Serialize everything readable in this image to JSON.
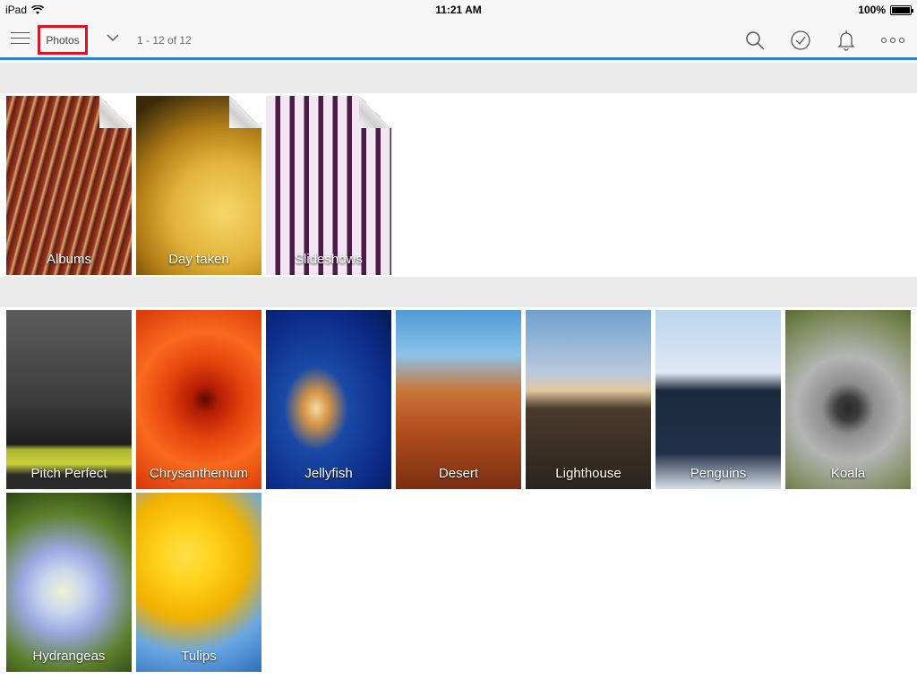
{
  "status_bar": {
    "device": "iPad",
    "time": "11:21 AM",
    "battery": "100%"
  },
  "toolbar": {
    "title": "Photos",
    "count": "1 - 12 of 12"
  },
  "views": [
    {
      "label": "Albums"
    },
    {
      "label": "Day taken"
    },
    {
      "label": "Slideshows"
    }
  ],
  "photos": [
    {
      "label": "Pitch Perfect"
    },
    {
      "label": "Chrysanthemum"
    },
    {
      "label": "Jellyfish"
    },
    {
      "label": "Desert"
    },
    {
      "label": "Lighthouse"
    },
    {
      "label": "Penguins"
    },
    {
      "label": "Koala"
    },
    {
      "label": "Hydrangeas"
    },
    {
      "label": "Tulips"
    }
  ],
  "colors": {
    "accent": "#2a7fd7",
    "highlight": "#e0141e"
  }
}
